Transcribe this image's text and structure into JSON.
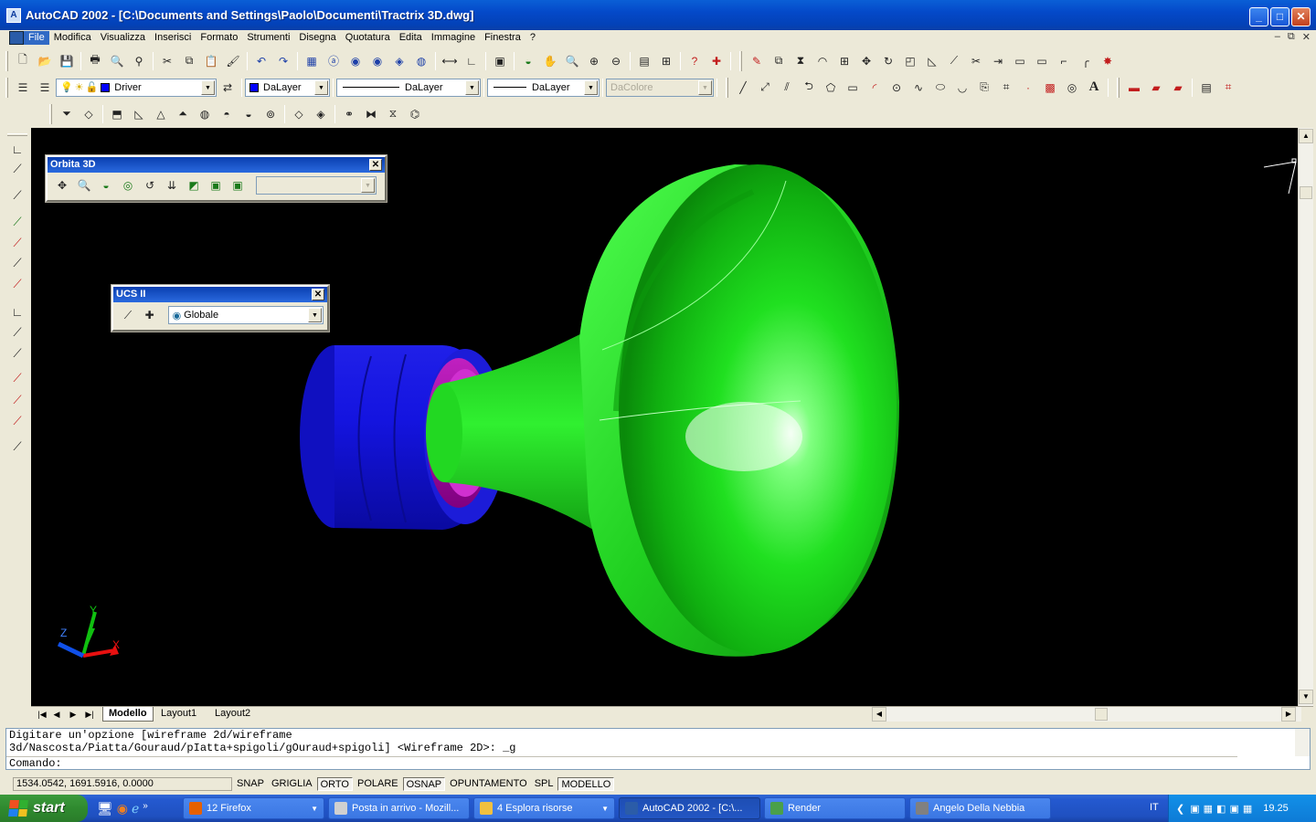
{
  "window": {
    "title": "AutoCAD 2002 - [C:\\Documents and Settings\\Paolo\\Documenti\\Tractrix 3D.dwg]",
    "app_icon": "A",
    "buttons": {
      "minimize": "_",
      "maximize": "□",
      "close": "✕"
    }
  },
  "menu": {
    "items": [
      "File",
      "Modifica",
      "Visualizza",
      "Inserisci",
      "Formato",
      "Strumenti",
      "Disegna",
      "Quotatura",
      "Edita",
      "Immagine",
      "Finestra",
      "?"
    ],
    "mdi": {
      "minimize": "–",
      "restore": "⧉",
      "close": "✕"
    }
  },
  "toolbar": {
    "layer_name": "Driver",
    "color": "DaLayer",
    "linetype": "DaLayer",
    "lineweight": "DaLayer",
    "plotstyle": "DaColore",
    "layer_color_hex": "#0000ff"
  },
  "palettes": {
    "orbit": {
      "title": "Orbita 3D",
      "close": "✕"
    },
    "ucs": {
      "title": "UCS II",
      "close": "✕",
      "value": "Globale"
    }
  },
  "ucs_icon": {
    "x": "X",
    "y": "Y",
    "z": "Z"
  },
  "layout_tabs": [
    "Modello",
    "Layout1",
    "Layout2"
  ],
  "command": {
    "line1": "Digitare un'opzione [wireframe 2d/wireframe",
    "line2": "3d/Nascosta/Piatta/Gouraud/pIatta+spigoli/gOuraud+spigoli] <Wireframe 2D>: _g",
    "prompt": "Comando:"
  },
  "status": {
    "coords": "1534.0542, 1691.5916, 0.0000",
    "toggles": [
      {
        "label": "SNAP",
        "on": false
      },
      {
        "label": "GRIGLIA",
        "on": false
      },
      {
        "label": "ORTO",
        "on": true
      },
      {
        "label": "POLARE",
        "on": false
      },
      {
        "label": "OSNAP",
        "on": true
      },
      {
        "label": "OPUNTAMENTO",
        "on": false
      },
      {
        "label": "SPL",
        "on": false
      },
      {
        "label": "MODELLO",
        "on": true
      }
    ]
  },
  "taskbar": {
    "start": "start",
    "tasks": [
      {
        "label": "12 Firefox",
        "icon_color": "#e66000",
        "active": false,
        "has_arrow": true
      },
      {
        "label": "Posta in arrivo - Mozill...",
        "icon_color": "#d0d0d0",
        "active": false,
        "has_arrow": false
      },
      {
        "label": "4 Esplora risorse",
        "icon_color": "#f0c040",
        "active": false,
        "has_arrow": true
      },
      {
        "label": "AutoCAD 2002 - [C:\\...",
        "icon_color": "#2b5ca8",
        "active": true,
        "has_arrow": false
      },
      {
        "label": "Render",
        "icon_color": "#4aa04a",
        "active": false,
        "has_arrow": false
      },
      {
        "label": "Angelo Della Nebbia",
        "icon_color": "#808080",
        "active": false,
        "has_arrow": false
      }
    ],
    "language": "IT",
    "clock": "19.25"
  },
  "colors": {
    "horn_green": "#00e000",
    "driver_blue": "#1010d8",
    "throat_magenta": "#b000b0",
    "viewport_bg": "#000000"
  }
}
